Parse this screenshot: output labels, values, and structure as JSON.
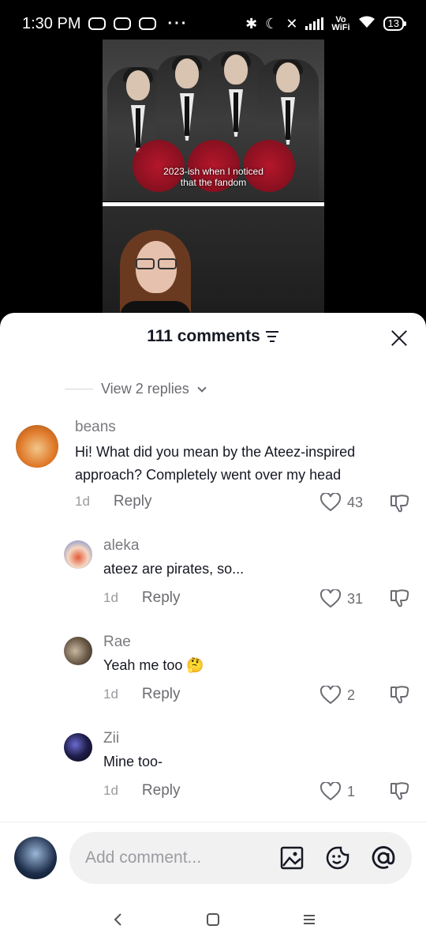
{
  "status_bar": {
    "time": "1:30 PM",
    "dots": "···",
    "vowifi_top": "Vo",
    "vowifi_bottom": "WiFi",
    "battery": "13"
  },
  "video": {
    "overlay_line1": "2023-ish when I noticed",
    "overlay_line2": "that the fandom"
  },
  "comments_sheet": {
    "title": "111 comments",
    "view_replies": "View 2 replies",
    "comments": [
      {
        "username": "beans",
        "text_line1": "Hi! What did you mean by the Ateez-inspired",
        "text_line2": "approach? Completely went over my head",
        "time": "1d",
        "reply_label": "Reply",
        "likes": "43"
      },
      {
        "username": "aleka",
        "text": "ateez are pirates, so...",
        "time": "1d",
        "reply_label": "Reply",
        "likes": "31"
      },
      {
        "username": "Rae",
        "text": "Yeah me too 🤔",
        "time": "1d",
        "reply_label": "Reply",
        "likes": "2"
      },
      {
        "username": "Zii",
        "text": "Mine too-",
        "time": "1d",
        "reply_label": "Reply",
        "likes": "1"
      }
    ]
  },
  "input_bar": {
    "placeholder": "Add comment..."
  },
  "colors": {
    "text_primary": "#161823",
    "text_secondary": "#6b6b72",
    "text_meta": "#9a9aa0"
  },
  "icons": {
    "filter": "filter-icon",
    "close": "close-icon",
    "heart": "heart-icon",
    "dislike": "dislike-icon",
    "image": "image-icon",
    "emoji": "emoji-icon",
    "mention": "at-icon"
  }
}
